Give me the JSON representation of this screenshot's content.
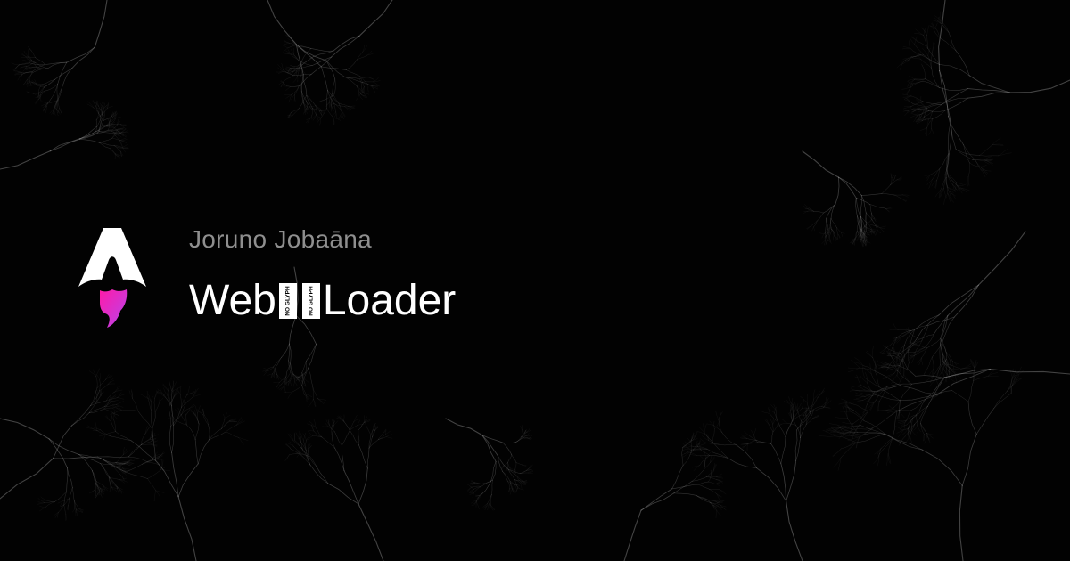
{
  "card": {
    "author": "Joruno Jobaāna",
    "title_start": "Web",
    "title_end": "Loader",
    "missing_glyph_icons": [
      "no-glyph-icon",
      "no-glyph-icon"
    ],
    "missing_glyph_text": "NO GLYPH"
  },
  "logo": {
    "icon": "astro-rocket-icon",
    "body_color": "#ffffff",
    "flame_gradient": [
      "#ff1aa8",
      "#b845ed"
    ]
  },
  "colors": {
    "background": "#020202",
    "author_text": "#8f8f8f",
    "title_text": "#ffffff",
    "texture": "#c8c8c8"
  }
}
